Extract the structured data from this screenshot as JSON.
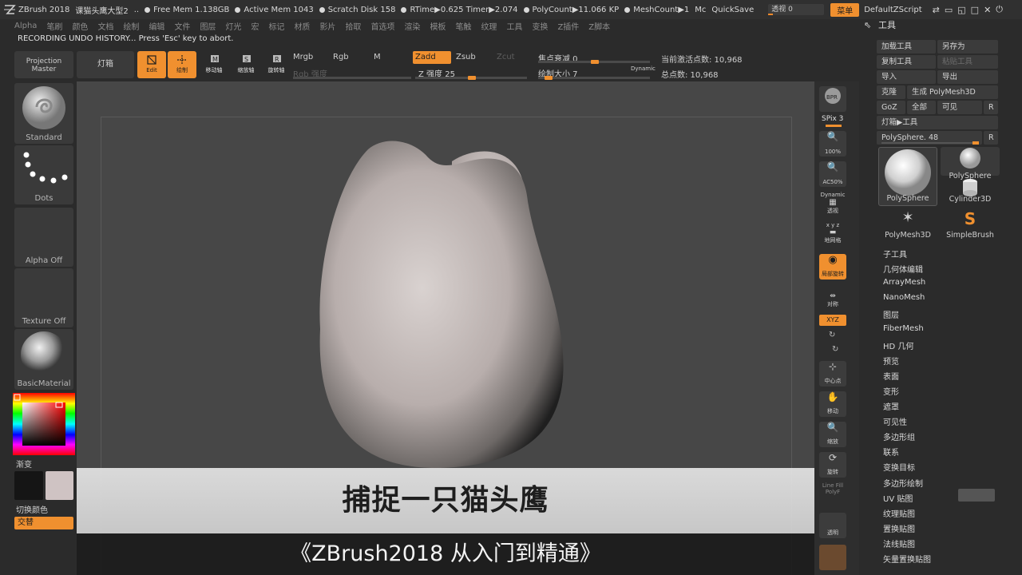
{
  "titlebar": {
    "app": "ZBrush 2018",
    "doc": "课猫头鹰大型2",
    "ellipsis": "..",
    "free_mem": "Free Mem 1.138GB",
    "active_mem": "Active Mem 1043",
    "scratch": "Scratch Disk 158",
    "rtime": "RTime▶0.625 Timer▶2.074",
    "polycount": "PolyCount▶11.066 KP",
    "meshcount": "MeshCount▶1",
    "mc": "Mc",
    "quicksave": "QuickSave",
    "transparency_label": "透视 0",
    "menu": "菜单",
    "script": "DefaultZScript"
  },
  "menubar": [
    "Alpha",
    "笔刷",
    "颜色",
    "文档",
    "绘制",
    "编辑",
    "文件",
    "图层",
    "灯光",
    "宏",
    "标记",
    "材质",
    "影片",
    "拾取",
    "首选项",
    "渲染",
    "模板",
    "笔触",
    "纹理",
    "工具",
    "变换",
    "Z插件",
    "Z脚本"
  ],
  "status_line": "RECORDING UNDO HISTORY... Press 'Esc' key to abort.",
  "toolbar": {
    "projection_master": "Projection Master",
    "lightbox": "灯箱",
    "edit": "Edit",
    "draw": "绘制",
    "move": "移动轴",
    "scale": "缩放轴",
    "rotate": "旋转轴",
    "mrgb": "Mrgb",
    "rgb": "Rgb",
    "m": "M",
    "rgb_intensity": "Rgb 强度",
    "zadd": "Zadd",
    "zsub": "Zsub",
    "zcut": "Zcut",
    "z_intensity": "Z 强度 25",
    "focal_shift": "焦点衰减 0",
    "draw_size": "绘制大小 7",
    "dynamic": "Dynamic",
    "active_points": "当前激活点数: 10,968",
    "total_points": "总点数: 10,968"
  },
  "left_shelf": {
    "brush": "Standard",
    "stroke": "Dots",
    "alpha": "Alpha Off",
    "texture": "Texture Off",
    "material": "BasicMaterial",
    "gradient": "渐变",
    "switch_color": "切换颜色",
    "alternate": "交替"
  },
  "right_shelf": {
    "bpr": "BPR",
    "spix": "SPix 3",
    "zoom100": "100%",
    "ac50": "AC50%",
    "dynamic": "Dynamic",
    "persp": "透视",
    "floor": "地网格",
    "xyz_small": "x y z",
    "local": "局部旋转",
    "sym": "对称",
    "xyz": "XYZ",
    "center": "中心点",
    "move": "移动",
    "scale": "缩放",
    "rotate": "旋转",
    "linefill": "Line Fill",
    "polyf": "PolyF",
    "transp": "透明"
  },
  "tool_panel": {
    "title": "工具",
    "load_tool": "加载工具",
    "save_as": "另存为",
    "copy_tool": "复制工具",
    "paste_tool": "粘贴工具",
    "import": "导入",
    "export": "导出",
    "clone": "克隆",
    "make_polymesh": "生成 PolyMesh3D",
    "goz": "GoZ",
    "all": "全部",
    "visible": "可见",
    "r": "R",
    "lightbox_tools": "灯箱▶工具",
    "current_tool": "PolySphere. 48",
    "thumbs": [
      "PolySphere",
      "PolySphere",
      "Cylinder3D",
      "PolyMesh3D",
      "SimpleBrush"
    ],
    "sections": [
      "子工具",
      "几何体编辑",
      "ArrayMesh",
      "NanoMesh",
      "图层",
      "FiberMesh",
      "HD 几何",
      "预览",
      "表面",
      "变形",
      "遮罩",
      "可见性",
      "多边形组",
      "联系",
      "变换目标",
      "多边形绘制",
      "UV 贴图",
      "纹理贴图",
      "置换贴图",
      "法线贴图",
      "矢量置换贴图"
    ]
  },
  "subtitle": {
    "main": "捕捉一只猫头鹰",
    "course": "《ZBrush2018 从入门到精通》"
  },
  "colors": {
    "accent": "#f0902f",
    "panel": "#3a3a3a",
    "canvas": "#474747"
  }
}
